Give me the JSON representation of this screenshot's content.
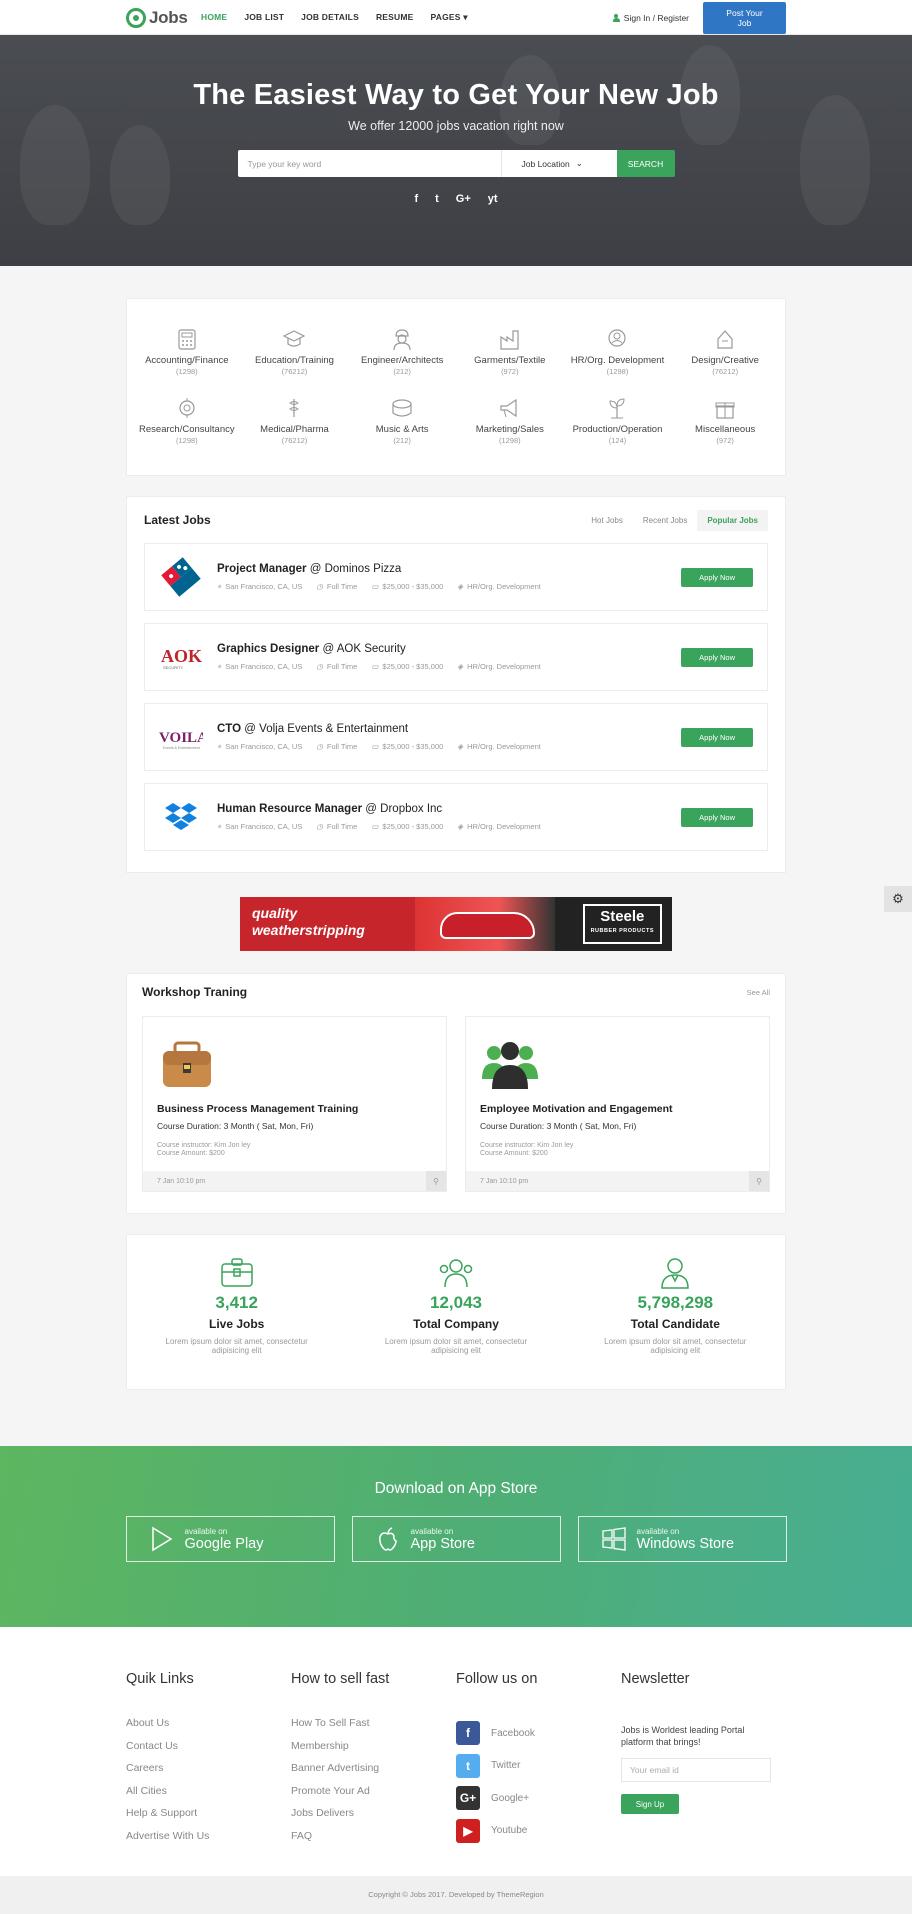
{
  "header": {
    "logo": "Jobs",
    "nav": [
      "HOME",
      "JOB LIST",
      "JOB DETAILS",
      "RESUME",
      "PAGES"
    ],
    "signin": "Sign In / Register",
    "post_job": "Post Your Job"
  },
  "hero": {
    "title": "The Easiest Way to Get Your New Job",
    "subtitle": "We offer 12000 jobs vacation right now",
    "search_placeholder": "Type your key word",
    "location_label": "Job Location",
    "search_button": "SEARCH",
    "social": [
      "f",
      "t",
      "G+",
      "yt"
    ]
  },
  "categories": [
    {
      "name": "Accounting/Finance",
      "count": "(1298)",
      "icon": "calculator-icon"
    },
    {
      "name": "Education/Training",
      "count": "(76212)",
      "icon": "graduation-cap-icon"
    },
    {
      "name": "Engineer/Architects",
      "count": "(212)",
      "icon": "engineer-icon"
    },
    {
      "name": "Garments/Textile",
      "count": "(972)",
      "icon": "factory-icon"
    },
    {
      "name": "HR/Org. Development",
      "count": "(1298)",
      "icon": "hr-icon"
    },
    {
      "name": "Design/Creative",
      "count": "(76212)",
      "icon": "design-icon"
    },
    {
      "name": "Research/Consultancy",
      "count": "(1298)",
      "icon": "research-icon"
    },
    {
      "name": "Medical/Pharma",
      "count": "(76212)",
      "icon": "medical-icon"
    },
    {
      "name": "Music & Arts",
      "count": "(212)",
      "icon": "drum-icon"
    },
    {
      "name": "Marketing/Sales",
      "count": "(1298)",
      "icon": "megaphone-icon"
    },
    {
      "name": "Production/Operation",
      "count": "(124)",
      "icon": "plant-icon"
    },
    {
      "name": "Miscellaneous",
      "count": "(972)",
      "icon": "gift-icon"
    }
  ],
  "latest": {
    "title": "Latest Jobs",
    "tabs": [
      "Hot Jobs",
      "Recent Jobs",
      "Popular Jobs"
    ],
    "jobs": [
      {
        "role": "Project Manager",
        "at": "@",
        "company": "Dominos Pizza",
        "location": "San Francisco, CA, US",
        "type": "Full Time",
        "salary": "$25,000 - $35,000",
        "category": "HR/Org. Development",
        "apply": "Apply Now",
        "logo": "dominos-logo"
      },
      {
        "role": "Graphics Designer",
        "at": "@",
        "company": "AOK Security",
        "location": "San Francisco, CA, US",
        "type": "Full Time",
        "salary": "$25,000 - $35,000",
        "category": "HR/Org. Development",
        "apply": "Apply Now",
        "logo": "aok-logo"
      },
      {
        "role": "CTO",
        "at": "@",
        "company": "Volja Events & Entertainment",
        "location": "San Francisco, CA, US",
        "type": "Full Time",
        "salary": "$25,000 - $35,000",
        "category": "HR/Org. Development",
        "apply": "Apply Now",
        "logo": "voila-logo"
      },
      {
        "role": "Human Resource Manager",
        "at": "@",
        "company": "Dropbox Inc",
        "location": "San Francisco, CA, US",
        "type": "Full Time",
        "salary": "$25,000 - $35,000",
        "category": "HR/Org. Development",
        "apply": "Apply Now",
        "logo": "dropbox-logo"
      }
    ]
  },
  "ad": {
    "line1": "quality",
    "line2": "weatherstripping",
    "brand": "Steele",
    "brand_sub": "RUBBER PRODUCTS"
  },
  "workshop": {
    "title": "Workshop Traning",
    "see_all": "See All",
    "items": [
      {
        "title": "Business Process Management Training",
        "duration": "Course Duration: 3 Month ( Sat, Mon, Fri)",
        "instructor": "Course instructor: Kim Jon ley",
        "amount": "Course Amount: $200",
        "date": "7 Jan 10:10 pm"
      },
      {
        "title": "Employee Motivation and Engagement",
        "duration": "Course Duration: 3 Month ( Sat, Mon, Fri)",
        "instructor": "Course instructor: Kim Jon ley",
        "amount": "Course Amount: $200",
        "date": "7 Jan 10:10 pm"
      }
    ]
  },
  "stats": [
    {
      "num": "3,412",
      "label": "Live Jobs",
      "desc": "Lorem ipsum dolor sit amet, consectetur adipisicing elit"
    },
    {
      "num": "12,043",
      "label": "Total Company",
      "desc": "Lorem ipsum dolor sit amet, consectetur adipisicing elit"
    },
    {
      "num": "5,798,298",
      "label": "Total Candidate",
      "desc": "Lorem ipsum dolor sit amet, consectetur adipisicing elit"
    }
  ],
  "app": {
    "title": "Download on App Store",
    "stores": [
      {
        "small": "available on",
        "name": "Google Play"
      },
      {
        "small": "available on",
        "name": "App Store"
      },
      {
        "small": "available on",
        "name": "Windows Store"
      }
    ]
  },
  "footer": {
    "quick_title": "Quik Links",
    "quick": [
      "About Us",
      "Contact Us",
      "Careers",
      "All Cities",
      "Help & Support",
      "Advertise With Us"
    ],
    "sell_title": "How to sell fast",
    "sell": [
      "How To Sell Fast",
      "Membership",
      "Banner Advertising",
      "Promote Your Ad",
      "Jobs Delivers",
      "FAQ"
    ],
    "follow_title": "Follow us on",
    "follow": [
      {
        "name": "Facebook",
        "glyph": "f",
        "color": "#3b5998"
      },
      {
        "name": "Twitter",
        "glyph": "t",
        "color": "#55acee"
      },
      {
        "name": "Google+",
        "glyph": "G+",
        "color": "#333333"
      },
      {
        "name": "Youtube",
        "glyph": "▶",
        "color": "#cd201f"
      }
    ],
    "news_title": "Newsletter",
    "news_text": "Jobs is Worldest leading Portal platform that brings!",
    "news_placeholder": "Your email id",
    "news_button": "Sign Up",
    "copyright": "Copyright © Jobs 2017. Developed by ThemeRegion"
  },
  "colors": {
    "accent": "#3aa35c",
    "primary": "#2f76c5"
  }
}
